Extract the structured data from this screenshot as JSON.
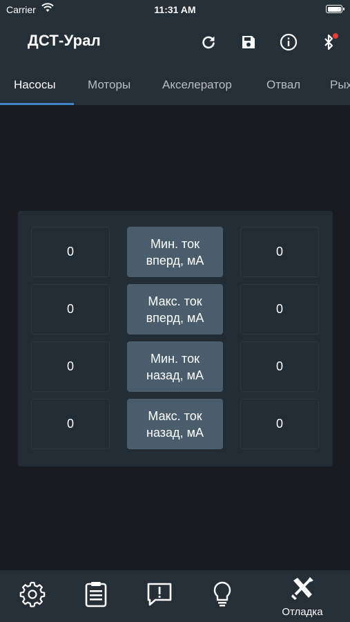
{
  "status_bar": {
    "carrier": "Carrier",
    "time": "11:31 AM"
  },
  "app_bar": {
    "title": "ДСТ-Урал",
    "actions": [
      "refresh-icon",
      "save-icon",
      "info-icon",
      "bluetooth-icon"
    ],
    "bluetooth_badge_color": "#e53935"
  },
  "tabs": [
    {
      "label": "Насосы",
      "active": true
    },
    {
      "label": "Моторы"
    },
    {
      "label": "Акселератор"
    },
    {
      "label": "Отвал"
    },
    {
      "label": "Рыхлитель"
    }
  ],
  "pumps": {
    "rows": [
      {
        "left": "0",
        "label": "Мин. ток\nвперд, мА",
        "right": "0"
      },
      {
        "left": "0",
        "label": "Макс. ток\nвперд, мА",
        "right": "0"
      },
      {
        "left": "0",
        "label": "Мин. ток\nназад, мА",
        "right": "0"
      },
      {
        "left": "0",
        "label": "Макс. ток\nназад, мА",
        "right": "0"
      }
    ]
  },
  "bottom_nav": {
    "items": [
      {
        "icon": "gear-icon"
      },
      {
        "icon": "clipboard-icon"
      },
      {
        "icon": "alert-message-icon"
      },
      {
        "icon": "lightbulb-icon"
      },
      {
        "icon": "tools-icon",
        "label": "Отладка",
        "active": true
      }
    ]
  },
  "colors": {
    "accent": "#3d84c8",
    "appbar": "#252f38",
    "background": "#181b1f",
    "button": "#4a5d6d"
  }
}
